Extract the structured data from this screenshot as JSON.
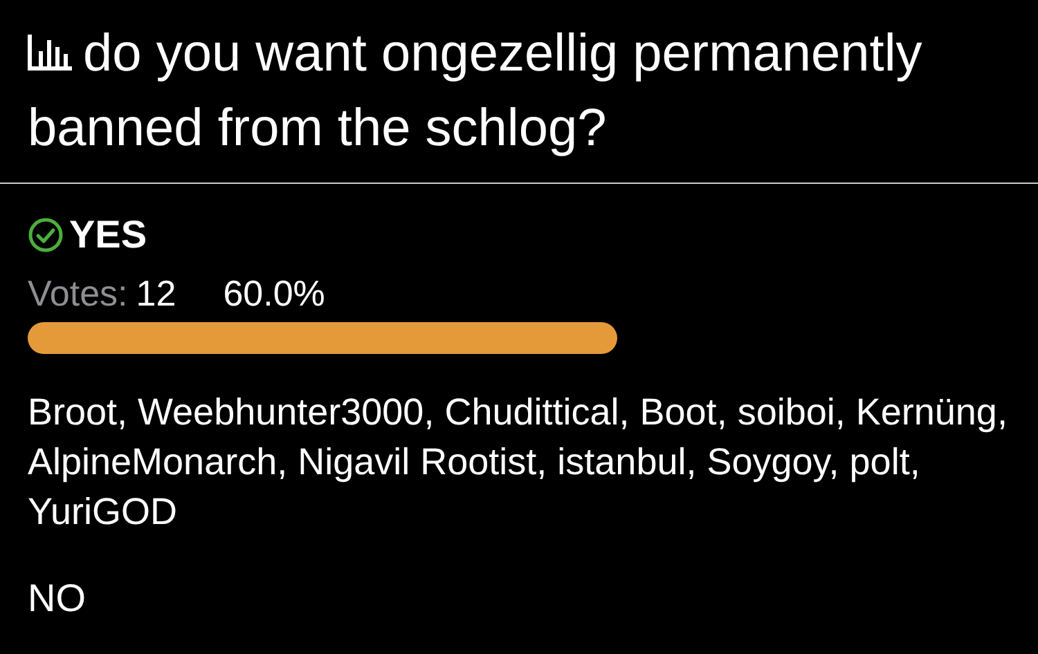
{
  "poll": {
    "question": "do you want ongezellig permanently banned from the schlog?",
    "options": [
      {
        "label": "YES",
        "chosen": true,
        "votes_label": "Votes:",
        "votes": "12",
        "percent": "60.0%",
        "voters": "Broot, Weebhunter3000, Chudittical, Boot, soiboi, Kernüng, AlpineMonarch, Nigavil Rootist, istanbul, Soygoy, polt, YuriGOD"
      },
      {
        "label": "NO",
        "chosen": false
      }
    ]
  }
}
